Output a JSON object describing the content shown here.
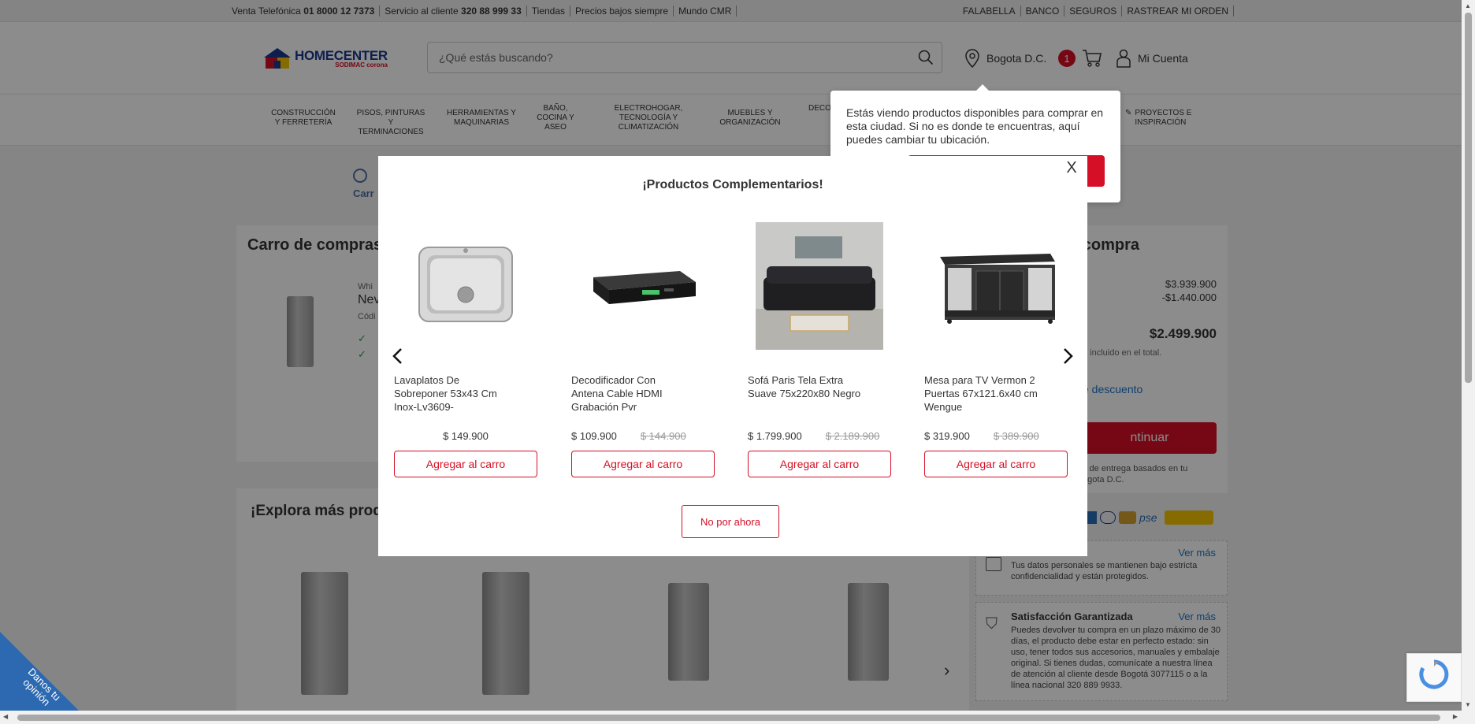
{
  "topbar": {
    "venta_label": "Venta Telefónica",
    "venta_number": "01 8000 12 7373",
    "servicio_label": "Servicio al cliente",
    "servicio_number": "320 88 999 33",
    "tiendas": "Tiendas",
    "precios": "Precios bajos siempre",
    "mundo": "Mundo CMR",
    "falabella": "FALABELLA",
    "banco": "BANCO",
    "seguros": "SEGUROS",
    "rastrear": "RASTREAR MI ORDEN"
  },
  "header": {
    "logo_main": "HOMECENTER",
    "logo_sub": "SODIMAC corona",
    "search_placeholder": "¿Qué estás buscando?",
    "location": "Bogota D.C.",
    "cart_count": "1",
    "account": "Mi Cuenta"
  },
  "nav": {
    "items": [
      "CONSTRUCCIÓN Y FERRETERÍA",
      "PISOS, PINTURAS Y TERMINACIONES",
      "HERRAMIENTAS Y MAQUINARIAS",
      "BAÑO, COCINA Y ASEO",
      "ELECTROHOGAR, TECNOLOGÍA Y CLIMATIZACIÓN",
      "MUEBLES Y ORGANIZACIÓN",
      "DECO",
      "PROYECTOS E INSPIRACIÓN"
    ]
  },
  "location_popover": {
    "text": "Estás viendo productos disponibles para comprar en esta ciudad. Si no es donde te encuentras, aquí puedes cambiar tu ubicación."
  },
  "background": {
    "step_label": "Carr",
    "cart_title": "Carro de compras",
    "explore_title": "¡Explora más prod",
    "summary_title": "u compra",
    "subtotal": "$3.939.900",
    "discount": "-$1.440.000",
    "total": "$2.499.900",
    "total_note": "á incluido en el total.",
    "discount_link": "e descuento",
    "continue": "ntinuar",
    "delivery_note": "s de entrega basados en tu",
    "delivery_city": "ogota D.C.",
    "ver_mas_1": "Ver más",
    "privacy_text": "Tus datos personales se mantienen bajo estricta confidencialidad y están protegidos.",
    "satisfaction_title": "Satisfacción Garantizada",
    "ver_mas_2": "Ver más",
    "satisfaction_text": "Puedes devolver tu compra en un plazo máximo de 30 días, el producto debe estar en perfecto estado: sin uso, tener todos sus accesorios, manuales y embalaje original. Si tienes dudas, comunícate a nuestra línea de atención al cliente desde Bogotá 3077115 o a la línea nacional 320 889 9933.",
    "item_brand": "Whi",
    "item_name": "Nev",
    "item_code": "Códi",
    "feedback": "Danos tu opinión"
  },
  "modal": {
    "title": "¡Productos Complementarios!",
    "close": "X",
    "no_thanks": "No por ahora",
    "add_label": "Agregar al carro",
    "products": [
      {
        "name": "Lavaplatos De Sobreponer 53x43 Cm Inox-Lv3609-",
        "price": "$ 149.900",
        "old_price": ""
      },
      {
        "name": "Decodificador Con Antena Cable HDMI Grabación Pvr",
        "price": "$ 109.900",
        "old_price": "$ 144.900"
      },
      {
        "name": "Sofá Paris Tela Extra Suave 75x220x80 Negro",
        "price": "$ 1.799.900",
        "old_price": "$ 2.189.900"
      },
      {
        "name": "Mesa para TV Vermon 2 Puertas 67x121.6x40 cm Wengue",
        "price": "$ 319.900",
        "old_price": "$ 389.900"
      }
    ]
  },
  "colors": {
    "brand_red": "#d50f25",
    "brand_blue": "#1a3a8f",
    "link_blue": "#1a73c9"
  }
}
